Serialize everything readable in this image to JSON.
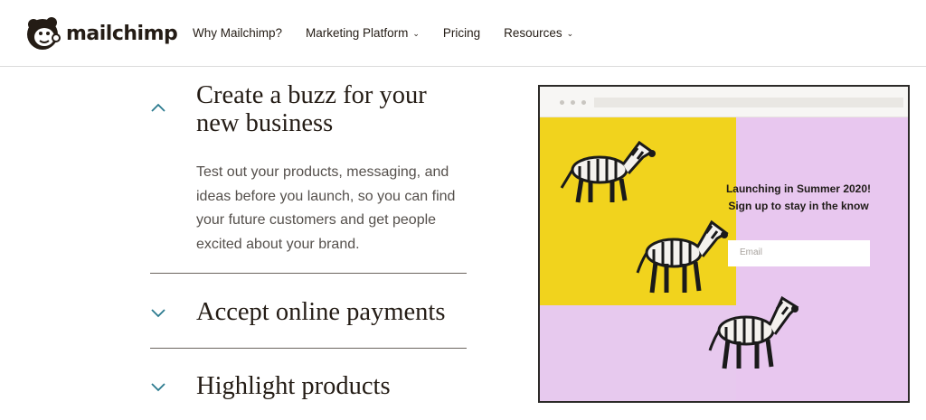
{
  "header": {
    "logo_text": "mailchimp",
    "nav": [
      {
        "label": "Why Mailchimp?",
        "has_dropdown": false
      },
      {
        "label": "Marketing Platform",
        "has_dropdown": true
      },
      {
        "label": "Pricing",
        "has_dropdown": false
      },
      {
        "label": "Resources",
        "has_dropdown": true
      }
    ]
  },
  "accordion": {
    "items": [
      {
        "title": "Create a buzz for your new business",
        "expanded": true,
        "body": "Test out your products, messaging, and ideas before you launch, so you can find your future customers and get people excited about your brand."
      },
      {
        "title": "Accept online payments",
        "expanded": false
      },
      {
        "title": "Highlight products",
        "expanded": false
      }
    ]
  },
  "preview": {
    "line1": "Launching in Summer 2020!",
    "line2": "Sign up to stay in the know",
    "email_placeholder": "Email"
  },
  "colors": {
    "text": "#241c15",
    "accent_teal": "#2b7a8e",
    "yellow": "#f1d31d",
    "pink": "#e8c7ef"
  },
  "icons": [
    "freddie-logo-icon",
    "chevron-down-icon",
    "chevron-up-icon",
    "zebra-figure-icon"
  ]
}
